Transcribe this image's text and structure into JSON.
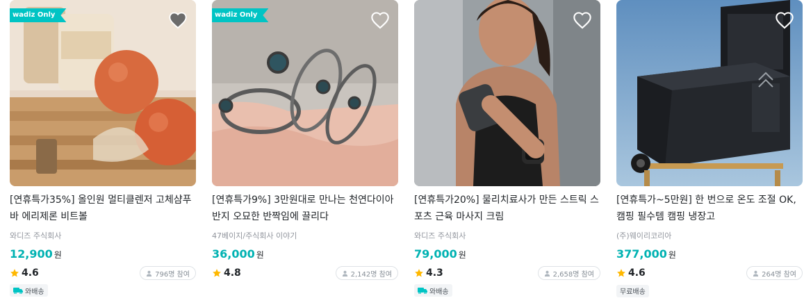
{
  "colors": {
    "accent": "#00c4c4",
    "price": "#00b2b2",
    "star": "#ffb800",
    "badge": "#00c4c4"
  },
  "cards": [
    {
      "badge": "wadiz Only",
      "title": "[연휴특가35%] 올인원 멀티클렌저 고체샴푸바 에리제론 비트볼",
      "maker": "와디즈 주식회사",
      "price": "12,900",
      "won": "원",
      "rating": "4.6",
      "participants": "796명 참여",
      "tag": "와배송",
      "tag_icon": "truck-icon"
    },
    {
      "badge": "wadiz Only",
      "title": "[연휴특가9%] 3만원대로 만나는 천연다이아 반지 오묘한 반짝임에 끌리다",
      "maker": "47베이지/주식회사 이야기",
      "price": "36,000",
      "won": "원",
      "rating": "4.8",
      "participants": "2,142명 참여",
      "tag": "",
      "tag_icon": ""
    },
    {
      "badge": "",
      "title": "[연휴특가20%] 물리치료사가 만든 스트릭 스포츠 근육 마사지 크림",
      "maker": "와디즈 주식회사",
      "price": "79,000",
      "won": "원",
      "rating": "4.3",
      "participants": "2,658명 참여",
      "tag": "와배송",
      "tag_icon": "truck-icon"
    },
    {
      "badge": "",
      "title": "[연휴특가~5만원] 한 번으로 온도 조절 OK, 캠핑 필수템 캠핑 냉장고",
      "maker": "(주)웨이리코리아",
      "price": "377,000",
      "won": "원",
      "rating": "4.6",
      "participants": "264명 참여",
      "tag": "무료배송",
      "tag_icon": ""
    }
  ]
}
